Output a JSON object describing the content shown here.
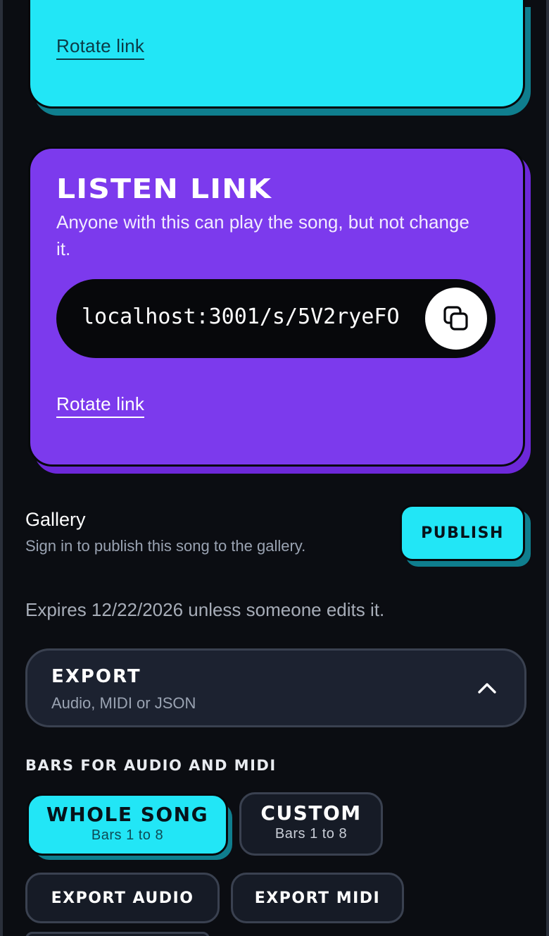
{
  "edit_card": {
    "rotate_label": "Rotate link"
  },
  "listen_card": {
    "title": "LISTEN LINK",
    "description": "Anyone with this can play the song, but not change it.",
    "url": "localhost:3001/s/5V2ryeFO",
    "copy_icon": "copy-icon",
    "rotate_label": "Rotate link"
  },
  "gallery": {
    "title": "Gallery",
    "subtitle": "Sign in to publish this song to the gallery.",
    "publish_label": "PUBLISH"
  },
  "expires_text": "Expires 12/22/2026 unless someone edits it.",
  "export": {
    "title": "EXPORT",
    "subtitle": "Audio, MIDI or JSON",
    "toggle_icon": "chevron-up-icon",
    "bars_heading": "BARS FOR AUDIO AND MIDI",
    "options": [
      {
        "label": "WHOLE SONG",
        "sub": "Bars 1 to 8",
        "selected": true
      },
      {
        "label": "CUSTOM",
        "sub": "Bars 1 to 8",
        "selected": false
      }
    ],
    "actions": {
      "audio_label": "EXPORT AUDIO",
      "midi_label": "EXPORT MIDI"
    }
  },
  "colors": {
    "background": "#0b0d12",
    "cyan": "#22e6f6",
    "purple": "#7c3aed",
    "panel": "#1c2230"
  }
}
